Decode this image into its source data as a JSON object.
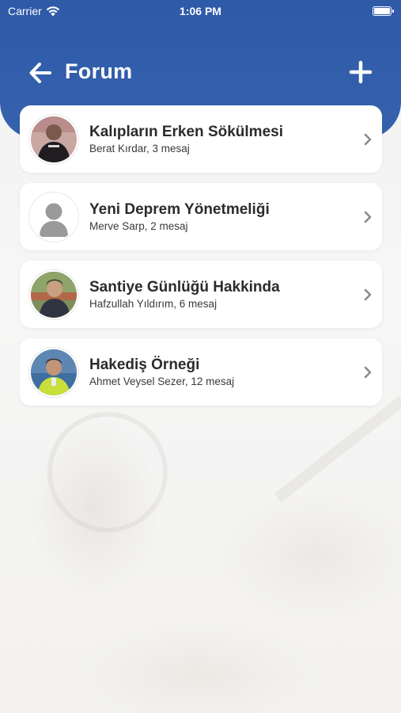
{
  "status_bar": {
    "carrier": "Carrier",
    "time": "1:06 PM"
  },
  "header": {
    "title": "Forum",
    "back_icon": "arrow-left-icon",
    "add_icon": "plus-icon",
    "color": "#3561ad"
  },
  "topics": [
    {
      "title": "Kalıpların Erken Sökülmesi",
      "subtitle": "Berat Kırdar, 3 mesaj"
    },
    {
      "title": "Yeni Deprem Yönetmeliği",
      "subtitle": "Merve Sarp, 2 mesaj"
    },
    {
      "title": "Santiye Günlüğü Hakkinda",
      "subtitle": "Hafzullah Yıldırım, 6 mesaj"
    },
    {
      "title": "Hakediş Örneği",
      "subtitle": "Ahmet Veysel Sezer, 12 mesaj"
    }
  ]
}
